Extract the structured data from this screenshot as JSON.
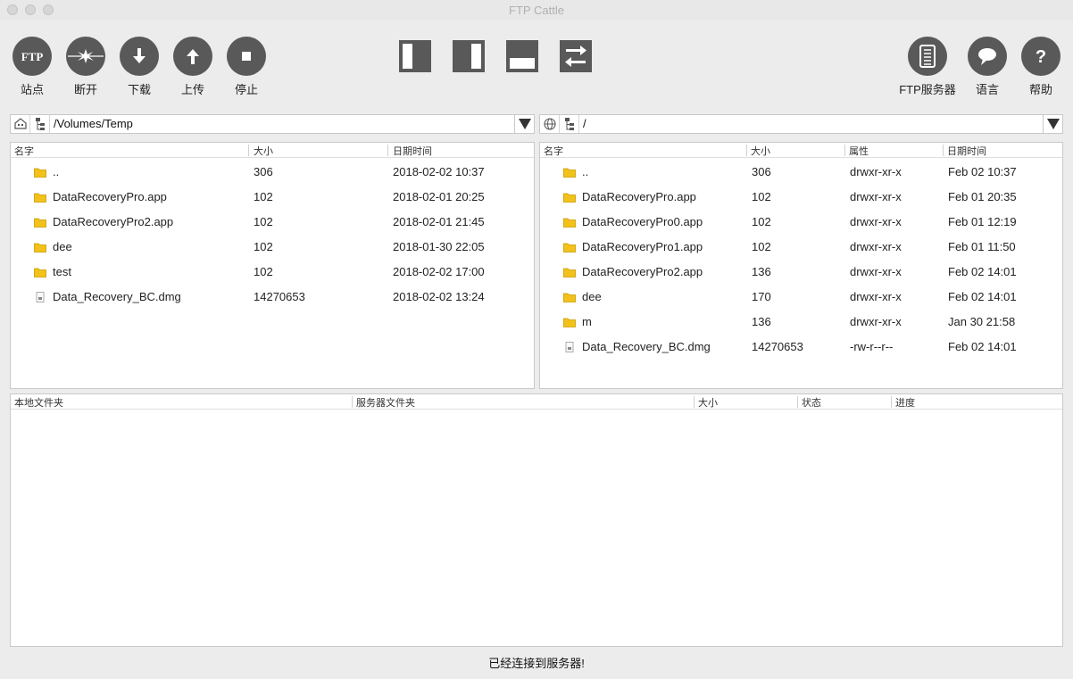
{
  "window": {
    "title": "FTP Cattle"
  },
  "toolbar": {
    "left": [
      {
        "label": "站点",
        "icon": "ftp-site-icon"
      },
      {
        "label": "断开",
        "icon": "disconnect-icon"
      },
      {
        "label": "下载",
        "icon": "download-arrow-icon"
      },
      {
        "label": "上传",
        "icon": "upload-arrow-icon"
      },
      {
        "label": "停止",
        "icon": "stop-icon"
      }
    ],
    "ftp_site_text": "FTP",
    "layout_buttons": [
      "layout-left-pane-icon",
      "layout-right-pane-icon",
      "layout-bottom-pane-icon",
      "swap-panes-icon"
    ],
    "right": [
      {
        "label": "FTP服务器",
        "icon": "ftp-server-icon"
      },
      {
        "label": "语言",
        "icon": "language-speech-icon"
      },
      {
        "label": "帮助",
        "icon": "help-question-icon"
      }
    ],
    "help_glyph": "?"
  },
  "local": {
    "path": "/Volumes/Temp",
    "columns": [
      "名字",
      "大小",
      "日期时间"
    ],
    "rows": [
      {
        "name": "..",
        "size": "306",
        "date": "2018-02-02 10:37",
        "type": "folder"
      },
      {
        "name": "DataRecoveryPro.app",
        "size": "102",
        "date": "2018-02-01 20:25",
        "type": "folder"
      },
      {
        "name": "DataRecoveryPro2.app",
        "size": "102",
        "date": "2018-02-01 21:45",
        "type": "folder"
      },
      {
        "name": "dee",
        "size": "102",
        "date": "2018-01-30 22:05",
        "type": "folder"
      },
      {
        "name": "test",
        "size": "102",
        "date": "2018-02-02 17:00",
        "type": "folder"
      },
      {
        "name": "Data_Recovery_BC.dmg",
        "size": "14270653",
        "date": "2018-02-02 13:24",
        "type": "file"
      }
    ]
  },
  "remote": {
    "path": "/",
    "columns": [
      "名字",
      "大小",
      "属性",
      "日期时间"
    ],
    "rows": [
      {
        "name": "..",
        "size": "306",
        "perm": "drwxr-xr-x",
        "date": "Feb 02 10:37",
        "type": "folder"
      },
      {
        "name": "DataRecoveryPro.app",
        "size": "102",
        "perm": "drwxr-xr-x",
        "date": "Feb 01 20:35",
        "type": "folder"
      },
      {
        "name": "DataRecoveryPro0.app",
        "size": "102",
        "perm": "drwxr-xr-x",
        "date": "Feb 01 12:19",
        "type": "folder"
      },
      {
        "name": "DataRecoveryPro1.app",
        "size": "102",
        "perm": "drwxr-xr-x",
        "date": "Feb 01 11:50",
        "type": "folder"
      },
      {
        "name": "DataRecoveryPro2.app",
        "size": "136",
        "perm": "drwxr-xr-x",
        "date": "Feb 02 14:01",
        "type": "folder"
      },
      {
        "name": "dee",
        "size": "170",
        "perm": "drwxr-xr-x",
        "date": "Feb 02 14:01",
        "type": "folder"
      },
      {
        "name": "m",
        "size": "136",
        "perm": "drwxr-xr-x",
        "date": "Jan 30 21:58",
        "type": "folder"
      },
      {
        "name": "Data_Recovery_BC.dmg",
        "size": "14270653",
        "perm": "-rw-r--r--",
        "date": "Feb 02 14:01",
        "type": "file"
      }
    ]
  },
  "queue": {
    "columns": [
      "本地文件夹",
      "服务器文件夹",
      "大小",
      "状态",
      "进度"
    ]
  },
  "status": "已经连接到服务器!",
  "colors": {
    "button": "#595959",
    "folder": "#f2c21b",
    "background": "#ececec"
  }
}
